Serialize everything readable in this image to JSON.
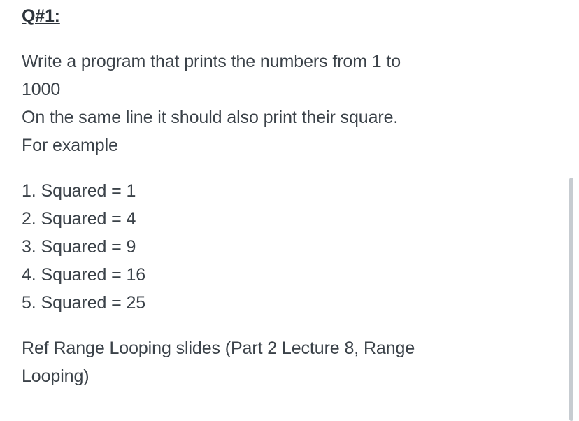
{
  "document": {
    "title": "Q#1:",
    "intro_lines": [
      "Write a program that prints the numbers from 1 to",
      "1000",
      "On the same line it should also print their square.",
      "For example"
    ],
    "examples": [
      "1. Squared = 1",
      "2. Squared = 4",
      "3. Squared = 9",
      "4. Squared = 16",
      "5. Squared = 25"
    ],
    "reference_lines": [
      "Ref Range Looping slides (Part 2 Lecture 8, Range",
      "Looping)"
    ]
  },
  "colors": {
    "text": "#3b4249",
    "heading": "#2d343b",
    "background": "#ffffff",
    "scrollbar": "#c7ccd1"
  }
}
